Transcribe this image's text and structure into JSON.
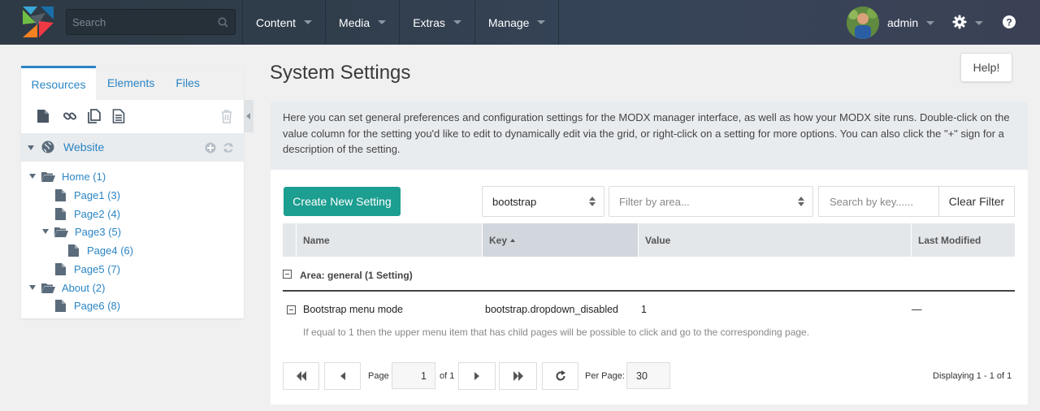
{
  "header": {
    "search_placeholder": "Search",
    "nav": [
      "Content",
      "Media",
      "Extras",
      "Manage"
    ],
    "username": "admin"
  },
  "sidebar": {
    "tabs": [
      "Resources",
      "Elements",
      "Files"
    ],
    "context_label": "Website",
    "tree": [
      {
        "label": "Home (1)",
        "type": "folder",
        "expanded": true
      },
      {
        "label": "Page1 (3)",
        "type": "page"
      },
      {
        "label": "Page2 (4)",
        "type": "page"
      },
      {
        "label": "Page3 (5)",
        "type": "folder",
        "expanded": true
      },
      {
        "label": "Page4 (6)",
        "type": "page"
      },
      {
        "label": "Page5 (7)",
        "type": "page"
      },
      {
        "label": "About (2)",
        "type": "folder",
        "expanded": true
      },
      {
        "label": "Page6 (8)",
        "type": "page"
      }
    ]
  },
  "main": {
    "title": "System Settings",
    "help_button": "Help!",
    "description": "Here you can set general preferences and configuration settings for the MODX manager interface, as well as how your MODX site runs. Double-click on the value column for the setting you'd like to edit to dynamically edit via the grid, or right-click on a setting for more options. You can also click the \"+\" sign for a description of the setting.",
    "create_button": "Create New Setting",
    "namespace_filter": "bootstrap",
    "area_filter_placeholder": "Filter by area...",
    "key_search_placeholder": "Search by key......",
    "clear_filter": "Clear Filter",
    "columns": [
      "Name",
      "Key",
      "Value",
      "Last Modified"
    ],
    "group_label": "Area: general (1 Setting)",
    "rows": [
      {
        "name": "Bootstrap menu mode",
        "key": "bootstrap.dropdown_disabled",
        "value": "1",
        "last_modified": "—",
        "description": "If equal to 1 then the upper menu item that has child pages will be possible to click and go to the corresponding page."
      }
    ],
    "pager": {
      "page_label": "Page",
      "page_value": "1",
      "of_label": "of 1",
      "per_page_label": "Per Page:",
      "per_page_value": "30",
      "displaying": "Displaying 1 - 1 of 1"
    }
  },
  "colors": {
    "accent": "#2b85c4",
    "create_button": "#1c9e90",
    "topbar": "#2f3d4b"
  }
}
